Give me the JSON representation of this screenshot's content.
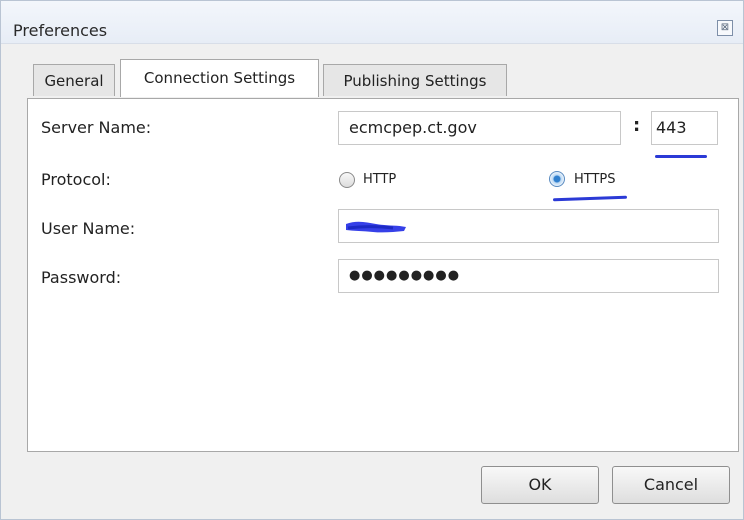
{
  "window": {
    "title": "Preferences",
    "close_symbol": "⊠"
  },
  "tabs": [
    {
      "label": "General"
    },
    {
      "label": "Connection Settings"
    },
    {
      "label": "Publishing Settings"
    }
  ],
  "active_tab": "Connection Settings",
  "form": {
    "server_label": "Server Name:",
    "server_value": "ecmcpep.ct.gov",
    "port_separator": ":",
    "port_value": "443",
    "protocol_label": "Protocol:",
    "protocol_options": [
      {
        "label": "HTTP",
        "selected": false
      },
      {
        "label": "HTTPS",
        "selected": true
      }
    ],
    "user_label": "User Name:",
    "user_value": "",
    "password_label": "Password:",
    "password_value": "●●●●●●●●●"
  },
  "buttons": {
    "ok": "OK",
    "cancel": "Cancel"
  },
  "colors": {
    "annotation": "#2b3ad6",
    "redaction": "#3640e8"
  }
}
